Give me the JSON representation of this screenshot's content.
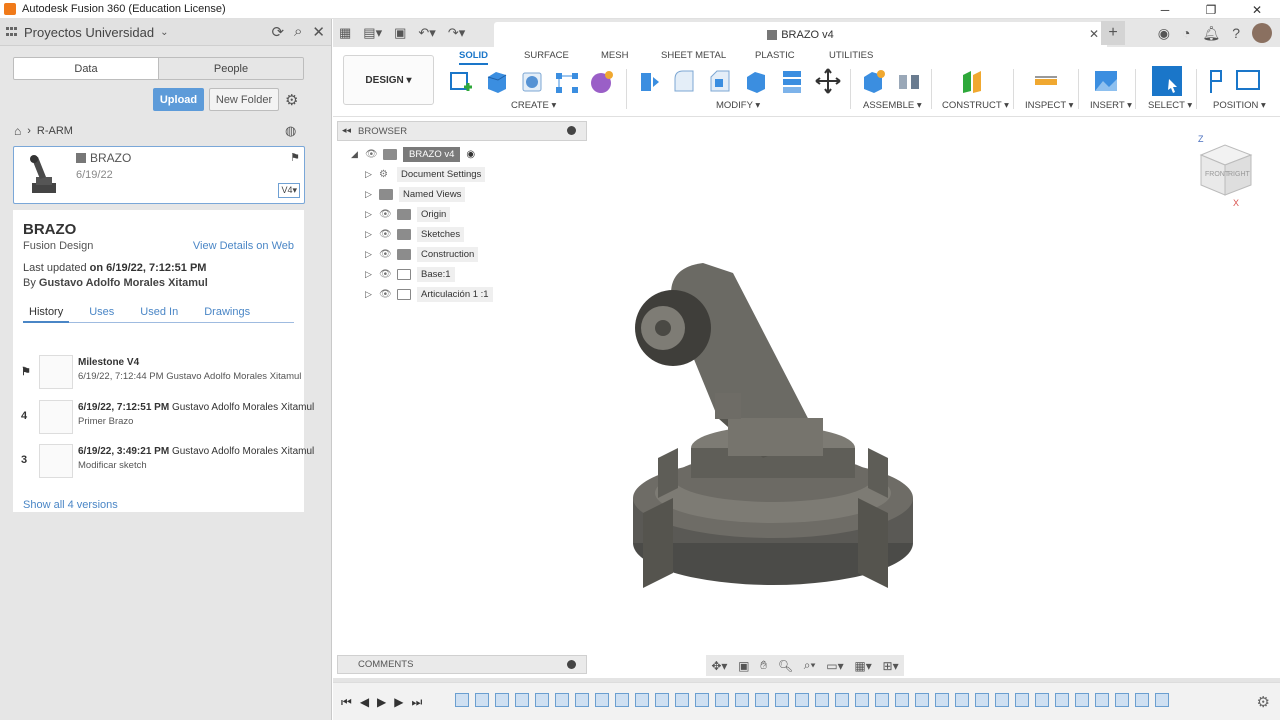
{
  "window": {
    "title": "Autodesk Fusion 360 (Education License)"
  },
  "data_panel": {
    "project_name": "Proyectos Universidad",
    "tabs": [
      "Data",
      "People"
    ],
    "upload_label": "Upload",
    "new_folder_label": "New Folder",
    "breadcrumb": "R-ARM",
    "file": {
      "name": "BRAZO",
      "date": "6/19/22",
      "version": "V4"
    },
    "details": {
      "title": "BRAZO",
      "subtitle": "Fusion Design",
      "view_link": "View Details on Web",
      "last_updated_prefix": "Last updated ",
      "last_updated_value": "on 6/19/22, 7:12:51 PM",
      "by_prefix": "By ",
      "by_value": "Gustavo Adolfo Morales Xitamul",
      "tabs": [
        "History",
        "Uses",
        "Used In",
        "Drawings"
      ],
      "history": [
        {
          "num": "",
          "line1_bold": "Milestone V4",
          "line1_rest": "",
          "line2": "6/19/22, 7:12:44 PM Gustavo Adolfo Morales Xitamul"
        },
        {
          "num": "4",
          "line1_bold": "6/19/22, 7:12:51 PM",
          "line1_rest": " Gustavo Adolfo Morales Xitamul",
          "line2": "Primer Brazo"
        },
        {
          "num": "3",
          "line1_bold": "6/19/22, 3:49:21 PM",
          "line1_rest": " Gustavo Adolfo Morales Xitamul",
          "line2": "Modificar sketch"
        }
      ],
      "show_all": "Show all 4 versions"
    }
  },
  "document_tab": {
    "title": "BRAZO v4"
  },
  "ribbon": {
    "workspace": "DESIGN",
    "tabs": [
      "SOLID",
      "SURFACE",
      "MESH",
      "SHEET METAL",
      "PLASTIC",
      "UTILITIES"
    ],
    "groups": [
      "CREATE",
      "MODIFY",
      "ASSEMBLE",
      "CONSTRUCT",
      "INSPECT",
      "INSERT",
      "SELECT",
      "POSITION"
    ]
  },
  "browser": {
    "title": "BROWSER",
    "root": "BRAZO v4",
    "nodes": [
      "Document Settings",
      "Named Views",
      "Origin",
      "Sketches",
      "Construction",
      "Base:1",
      "Articulación 1 :1"
    ]
  },
  "viewcube": {
    "front": "FRONT",
    "right": "RIGHT",
    "z": "Z",
    "x": "X"
  },
  "comments": {
    "title": "COMMENTS"
  },
  "colors": {
    "accent": "#1a76c9",
    "upload": "#5d9bd9",
    "link": "#4a86c6"
  }
}
